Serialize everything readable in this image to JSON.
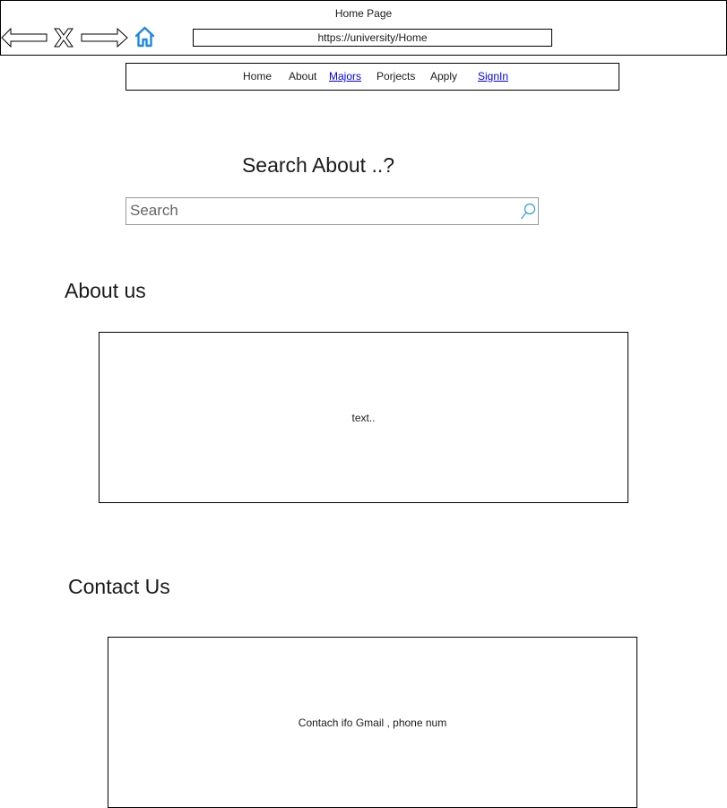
{
  "window": {
    "title": "Home Page",
    "url": "https://university/Home"
  },
  "icons": {
    "back": "back-arrow-icon",
    "close": "close-x-icon",
    "forward": "forward-arrow-icon",
    "home": "home-icon",
    "search": "search-icon",
    "home_color": "#1e88e5",
    "search_color": "#2f9bd6"
  },
  "nav": {
    "home": "Home",
    "about": "About",
    "majors": "Majors",
    "projects": "Porjects",
    "apply": "Apply",
    "signin": "SignIn"
  },
  "search": {
    "heading": "Search About ..?",
    "placeholder": "Search"
  },
  "about": {
    "heading": "About us",
    "body": "text.."
  },
  "contact": {
    "heading": "Contact Us",
    "body": "Contach ifo Gmail , phone num"
  }
}
